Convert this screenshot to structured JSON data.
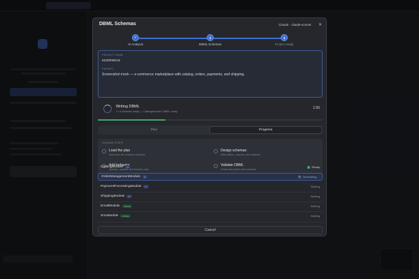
{
  "background": {
    "brand": "",
    "tab_label": "",
    "welcome_title": ""
  },
  "modal": {
    "title": "DBML Schemas",
    "model": "Claude · claude-sonnet",
    "close_icon": "close-icon"
  },
  "stepper": {
    "steps": [
      {
        "num": "✓",
        "label": "AI Analysis",
        "state": "done"
      },
      {
        "num": "2",
        "label": "DBML Schemas",
        "state": "active"
      },
      {
        "num": "3",
        "label": "Project ready",
        "state": "pending"
      }
    ],
    "colors": {
      "done": "#3d6fd1",
      "active": "#3d6fd1",
      "pending": "#3d6fd1"
    }
  },
  "project": {
    "name_label": "PROJECT NAME",
    "name": "ecommerce",
    "desc_label": "PROMPT",
    "description": "Screenshot mock — e-commerce marketplace with catalog, orders, payments, and shipping."
  },
  "status": {
    "title": "Writing DBML",
    "subtitle": "1 / 6 Modules ready — CatalogModule: DBML ready",
    "elapsed": "1:56",
    "progress": 0.3
  },
  "tabs": [
    {
      "label": "Plan",
      "active": false
    },
    {
      "label": "Progress",
      "active": true
    }
  ],
  "steps": {
    "header": "SCHEMA STEPS",
    "items": [
      {
        "title": "Load the plan",
        "desc": "Start from the reviewed modules"
      },
      {
        "title": "Design schemas",
        "desc": "Write tables, columns, and relations"
      },
      {
        "title": "Add behavior",
        "desc": "Queries, updates, and domain rules"
      },
      {
        "title": "Validate DBML",
        "desc": "Check and polish each schema"
      }
    ]
  },
  "modules": [
    {
      "name": "CatalogModule",
      "badge": "AI",
      "badge_type": "blue",
      "status": "Ready",
      "state": "ready"
    },
    {
      "name": "OrderManagementModule",
      "badge": "AI",
      "badge_type": "blue",
      "status": "Generating…",
      "state": "generating"
    },
    {
      "name": "PaymentProcessingModule",
      "badge": "AI",
      "badge_type": "blue",
      "status": "Waiting",
      "state": "waiting"
    },
    {
      "name": "ShippingModule",
      "badge": "AI",
      "badge_type": "blue",
      "status": "Waiting",
      "state": "waiting"
    },
    {
      "name": "EmailModule",
      "badge": "Library",
      "badge_type": "green",
      "status": "Waiting",
      "state": "waiting"
    },
    {
      "name": "SmsModule",
      "badge": "Library",
      "badge_type": "green",
      "status": "Waiting",
      "state": "waiting"
    }
  ],
  "cancel_label": "Cancel"
}
